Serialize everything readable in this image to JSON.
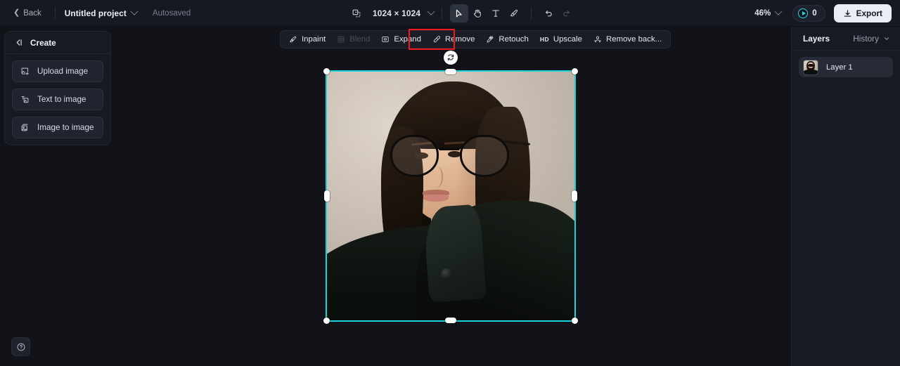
{
  "topbar": {
    "back_label": "Back",
    "project_name": "Untitled project",
    "autosave_status": "Autosaved",
    "canvas_size": "1024 × 1024",
    "zoom_level": "46%",
    "credits_count": "0",
    "export_label": "Export",
    "tools": [
      {
        "name": "select-tool",
        "title": "Select",
        "active": true
      },
      {
        "name": "hand-tool",
        "title": "Pan",
        "active": false
      },
      {
        "name": "text-tool",
        "title": "Text",
        "active": false
      },
      {
        "name": "brush-tool",
        "title": "Brush",
        "active": false
      },
      {
        "name": "undo-tool",
        "title": "Undo",
        "active": false
      },
      {
        "name": "redo-tool",
        "title": "Redo",
        "active": false
      }
    ]
  },
  "create_panel": {
    "title": "Create",
    "collapse_icon": "collapse-left-icon",
    "items": [
      {
        "label": "Upload image",
        "icon": "upload-image-icon"
      },
      {
        "label": "Text to image",
        "icon": "text-to-image-icon"
      },
      {
        "label": "Image to image",
        "icon": "image-to-image-icon"
      }
    ]
  },
  "action_toolbar": {
    "actions": [
      {
        "label": "Inpaint",
        "icon": "inpaint-icon",
        "disabled": false,
        "highlighted": false
      },
      {
        "label": "Blend",
        "icon": "blend-icon",
        "disabled": true,
        "highlighted": false
      },
      {
        "label": "Expand",
        "icon": "expand-icon",
        "disabled": false,
        "highlighted": false
      },
      {
        "label": "Remove",
        "icon": "remove-icon",
        "disabled": false,
        "highlighted": true
      },
      {
        "label": "Retouch",
        "icon": "retouch-icon",
        "disabled": false,
        "highlighted": false
      },
      {
        "label": "HD Upscale",
        "icon": "hd-upscale-icon",
        "disabled": false,
        "highlighted": false
      },
      {
        "label": "Remove back...",
        "icon": "remove-background-icon",
        "disabled": false,
        "highlighted": false
      }
    ]
  },
  "canvas": {
    "selection_color": "#18d4da",
    "rotate_handle_icon": "rotate-icon",
    "artwork_alt": "Portrait of a woman with dark hair wearing round black glasses and a black high-collar coat on a beige background"
  },
  "layers_panel": {
    "tab_layers": "Layers",
    "tab_history": "History",
    "layers": [
      {
        "name": "Layer 1"
      }
    ]
  },
  "help": {
    "icon": "help-circle-icon",
    "label": "Help"
  },
  "colors": {
    "accent_cyan": "#18d4da",
    "highlight_red": "#ef1b1b",
    "panel_bg": "#171a23",
    "canvas_bg": "#121318",
    "topbar_bg": "#171922"
  }
}
